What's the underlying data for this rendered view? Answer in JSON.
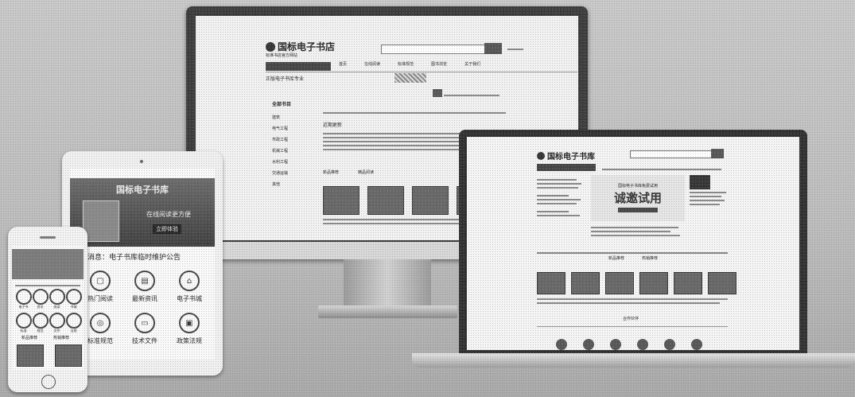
{
  "site": {
    "logo_text": "国标电子书店",
    "logo_text_alt": "国标电子书库",
    "logo_sub": "标准书店官方网站"
  },
  "monitor": {
    "nav": [
      "首页",
      "在线阅读",
      "标准规范",
      "图书浏览",
      "关于我们"
    ],
    "breadcrumb": "正版电子书库专业",
    "sidebar_title": "全部书目",
    "sidebar_items": [
      "建筑",
      "电气工程",
      "市政工程",
      "机械工程",
      "水利工程",
      "交通运输",
      "其他"
    ],
    "tabs": [
      "新品推荐",
      "精品阅读"
    ],
    "list_header": "近期更新",
    "list_rows": 6,
    "thumb_count": 4
  },
  "laptop": {
    "banner_title": "诚邀试用",
    "banner_sub": "国标电子书库免费试用",
    "section_tabs": [
      "新品推荐",
      "热销推荐"
    ],
    "footer_title": "合作伙伴",
    "thumb_count": 6,
    "partner_count": 6
  },
  "tablet": {
    "banner_title": "国标电子书库",
    "banner_sub": "在线阅读更方便",
    "banner_btn": "立即体验",
    "notice": "最新消息：电子书库临时维护公告",
    "icons": [
      {
        "label": "热门阅读",
        "icon": "book-icon"
      },
      {
        "label": "最新资讯",
        "icon": "news-icon"
      },
      {
        "label": "电子书城",
        "icon": "store-icon"
      },
      {
        "label": "标准规范",
        "icon": "standard-icon"
      },
      {
        "label": "技术文件",
        "icon": "file-icon"
      },
      {
        "label": "政策法规",
        "icon": "law-icon"
      }
    ]
  },
  "phone": {
    "icons": [
      "电子书",
      "资讯",
      "阅读",
      "书城",
      "标准",
      "规范",
      "文件",
      "法规"
    ],
    "section_labels": [
      "新品推荐",
      "热销推荐"
    ]
  }
}
